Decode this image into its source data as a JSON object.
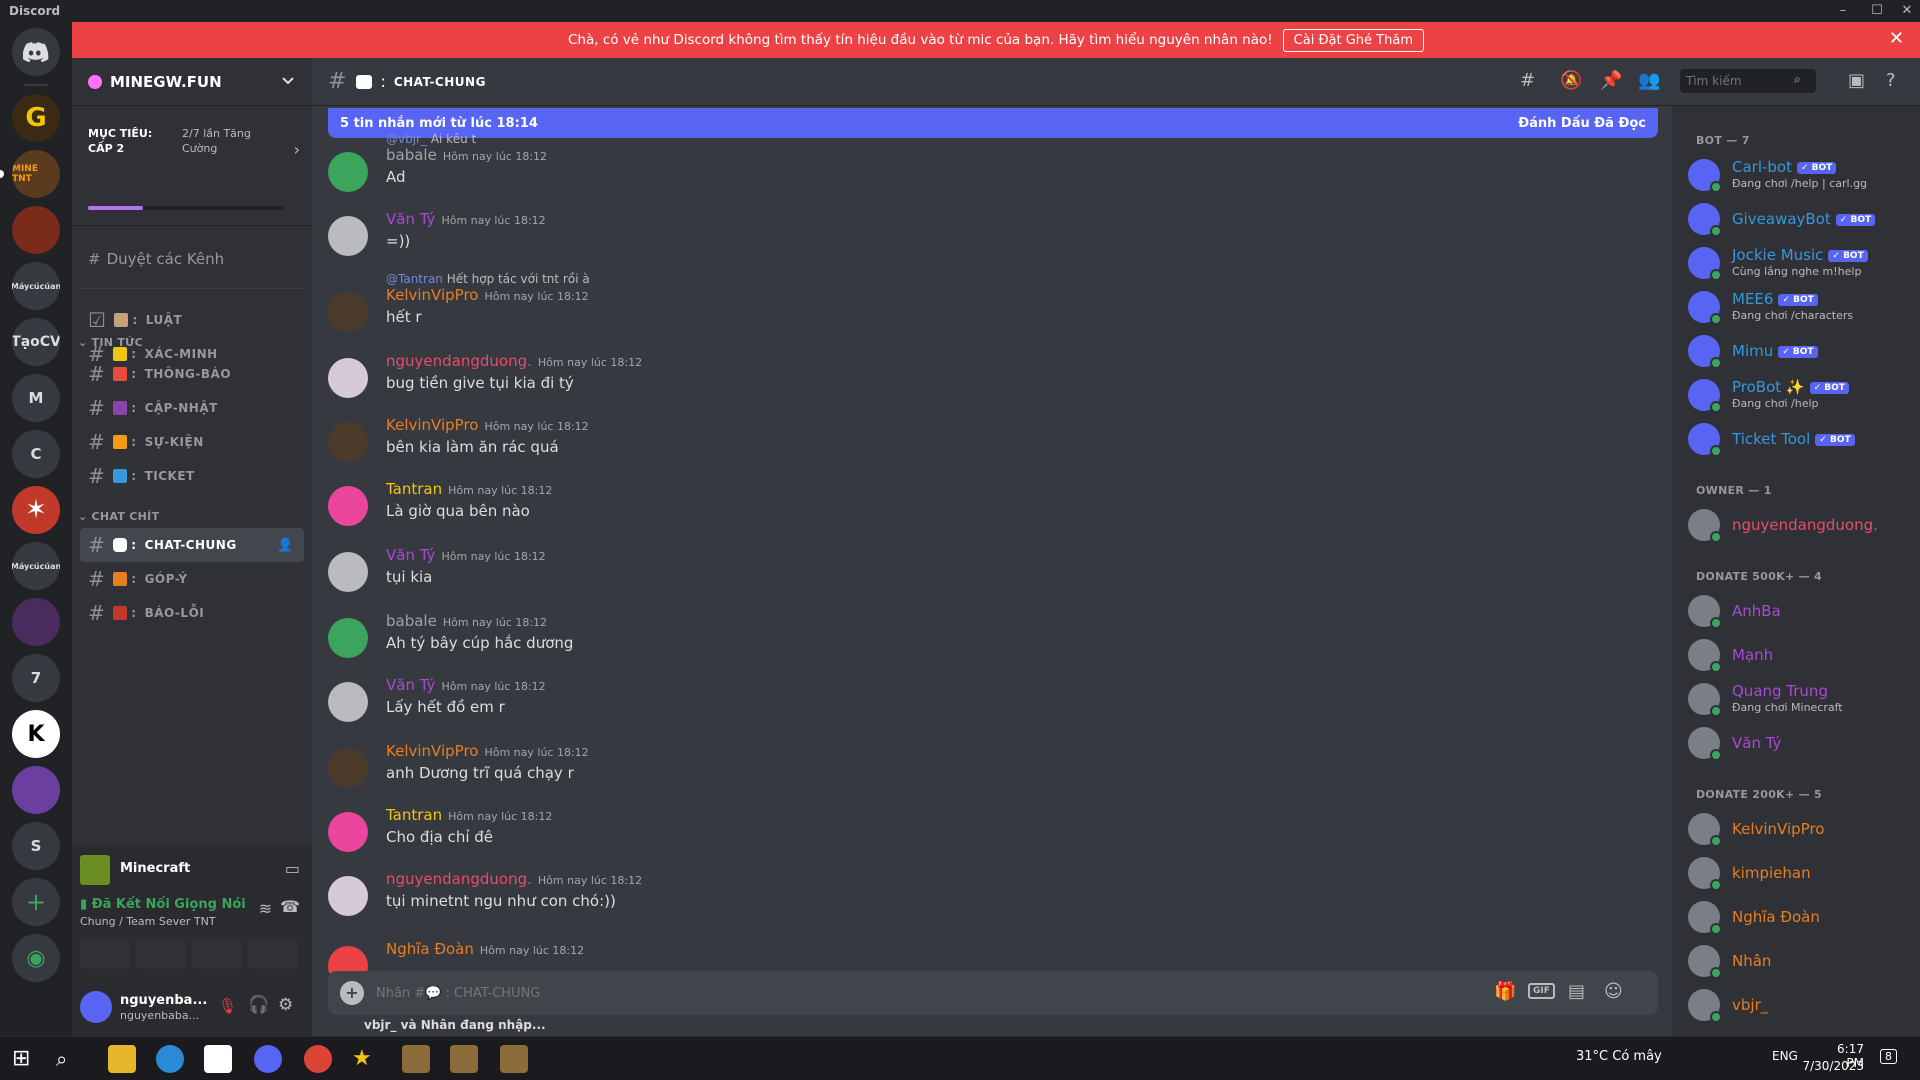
{
  "window": {
    "title": "Discord"
  },
  "notice": {
    "text": "Chà, có vẻ như Discord không tìm thấy tín hiệu đầu vào từ mic của bạn. Hãy tìm hiểu nguyên nhân nào!",
    "cta": "Cài Đặt Ghé Thăm"
  },
  "guilds": {
    "items": [
      "G",
      "MINE TNT",
      "Máycúcúan",
      "TạoCV",
      "M",
      "C",
      "Máycúcúan",
      "7",
      "S"
    ]
  },
  "server": {
    "name": "MINEGW.FUN",
    "boost_goal": "MỤC TIÊU: CẤP 2",
    "boost_count": "2/7 lần Tăng Cường",
    "boost_progress": 0.28,
    "browse": "Duyệt các Kênh"
  },
  "channels": {
    "top": [
      {
        "name": "LUẬT"
      },
      {
        "name": "XÁC-MINH"
      }
    ],
    "categories": [
      {
        "name": "TIN TỨC",
        "items": [
          {
            "name": "THÔNG-BÁO"
          },
          {
            "name": "CẬP-NHẬT"
          },
          {
            "name": "SỰ-KIỆN"
          },
          {
            "name": "TICKET"
          }
        ]
      },
      {
        "name": "CHAT CHÍT",
        "items": [
          {
            "name": "CHAT-CHUNG"
          },
          {
            "name": "GÓP-Ý"
          },
          {
            "name": "BÁO-LỖI"
          }
        ]
      }
    ]
  },
  "activity": {
    "game": "Minecraft",
    "voice_status": "Đã Kết Nối Giọng Nói",
    "voice_channel": "Chung / Team Sever TNT"
  },
  "user": {
    "name": "nguyenba...",
    "tag": "nguyenbaba..."
  },
  "header": {
    "channel": "CHAT-CHUNG",
    "search_placeholder": "Tìm kiếm"
  },
  "newbar": {
    "text": "5 tin nhắn mới từ lúc 18:14",
    "mark": "Đánh Dấu Đã Đọc"
  },
  "messages": [
    {
      "author": "babale",
      "time": "Hôm nay lúc 18:12",
      "text": "Ad",
      "color": "#9ea3a9",
      "reply": {
        "to": "@vbjr_",
        "text": "Ai kêu t"
      }
    },
    {
      "author": "Văn Tý",
      "time": "Hôm nay lúc 18:12",
      "text": "=))",
      "color": "#a64bd2"
    },
    {
      "author": "KelvinVipPro",
      "time": "Hôm nay lúc 18:12",
      "text": "hết r",
      "color": "#e67e22",
      "reply": {
        "to": "@Tantran",
        "text": "Hết hợp tác với tnt rồi à"
      }
    },
    {
      "author": "nguyendangduong.",
      "time": "Hôm nay lúc 18:12",
      "text": "bug tiền give tụi kia đi tý",
      "color": "#e74c6c"
    },
    {
      "author": "KelvinVipPro",
      "time": "Hôm nay lúc 18:12",
      "text": "bên kia làm ăn rác quá",
      "color": "#e67e22"
    },
    {
      "author": "Tantran",
      "time": "Hôm nay lúc 18:12",
      "text": "Là giờ qua bên nào",
      "color": "#f1c40f"
    },
    {
      "author": "Văn Tý",
      "time": "Hôm nay lúc 18:12",
      "text": "tụi kia",
      "color": "#a64bd2"
    },
    {
      "author": "babale",
      "time": "Hôm nay lúc 18:12",
      "text": "Ah tý bây cúp hắc dương",
      "color": "#9ea3a9"
    },
    {
      "author": "Văn Tý",
      "time": "Hôm nay lúc 18:12",
      "text": "Lấy hết đồ em r",
      "color": "#a64bd2"
    },
    {
      "author": "KelvinVipPro",
      "time": "Hôm nay lúc 18:12",
      "text": "anh Dương trĩ quá chạy r",
      "color": "#e67e22"
    },
    {
      "author": "Tantran",
      "time": "Hôm nay lúc 18:12",
      "text": "Cho địa chỉ đê",
      "color": "#f1c40f"
    },
    {
      "author": "nguyendangduong.",
      "time": "Hôm nay lúc 18:12",
      "text": "tụi minetnt ngu như con chó:))",
      "color": "#e74c6c"
    },
    {
      "author": "Nghĩa Đoàn",
      "time": "Hôm nay lúc 18:12",
      "text": "",
      "color": "#e67e22"
    }
  ],
  "composer": {
    "placeholder": "Nhắn #💬 : CHAT-CHUNG",
    "typing": "vbjr_ và Nhân đang nhập..."
  },
  "members": {
    "groups": [
      {
        "title": "BOT — 7",
        "items": [
          {
            "name": "Carl-bot",
            "bot": true,
            "sub": "Đang chơi /help | carl.gg",
            "color": "#3498db"
          },
          {
            "name": "GiveawayBot",
            "bot": true,
            "sub": "",
            "color": "#3498db"
          },
          {
            "name": "Jockie Music",
            "bot": true,
            "sub": "Cùng lắng nghe m!help",
            "color": "#3498db"
          },
          {
            "name": "MEE6",
            "bot": true,
            "sub": "Đang chơi /characters",
            "color": "#3498db"
          },
          {
            "name": "Mimu",
            "bot": true,
            "sub": "",
            "color": "#3498db"
          },
          {
            "name": "ProBot ✨",
            "bot": true,
            "sub": "Đang chơi /help",
            "color": "#3498db"
          },
          {
            "name": "Ticket Tool",
            "bot": true,
            "sub": "",
            "color": "#3498db"
          }
        ]
      },
      {
        "title": "OWNER — 1",
        "items": [
          {
            "name": "nguyendangduong.",
            "bot": false,
            "sub": "",
            "color": "#e74c6c"
          }
        ]
      },
      {
        "title": "DONATE 500K+ — 4",
        "items": [
          {
            "name": "AnhBa",
            "bot": false,
            "sub": "",
            "color": "#a64bd2"
          },
          {
            "name": "Mạnh",
            "bot": false,
            "sub": "",
            "color": "#a64bd2"
          },
          {
            "name": "Quang Trung",
            "bot": false,
            "sub": "Đang chơi Minecraft",
            "color": "#a64bd2"
          },
          {
            "name": "Văn Tý",
            "bot": false,
            "sub": "",
            "color": "#a64bd2"
          }
        ]
      },
      {
        "title": "DONATE 200K+ — 5",
        "items": [
          {
            "name": "KelvinVipPro",
            "bot": false,
            "sub": "",
            "color": "#e67e22"
          },
          {
            "name": "kimpiehan",
            "bot": false,
            "sub": "",
            "color": "#e67e22"
          },
          {
            "name": "Nghĩa Đoàn",
            "bot": false,
            "sub": "",
            "color": "#e67e22"
          },
          {
            "name": "Nhân",
            "bot": false,
            "sub": "",
            "color": "#e67e22"
          },
          {
            "name": "vbjr_",
            "bot": false,
            "sub": "",
            "color": "#e67e22"
          }
        ]
      }
    ]
  },
  "taskbar": {
    "weather": "31°C  Có mây",
    "lang": "ENG",
    "time": "6:17 PM",
    "date": "7/30/2023",
    "notif": "8"
  }
}
